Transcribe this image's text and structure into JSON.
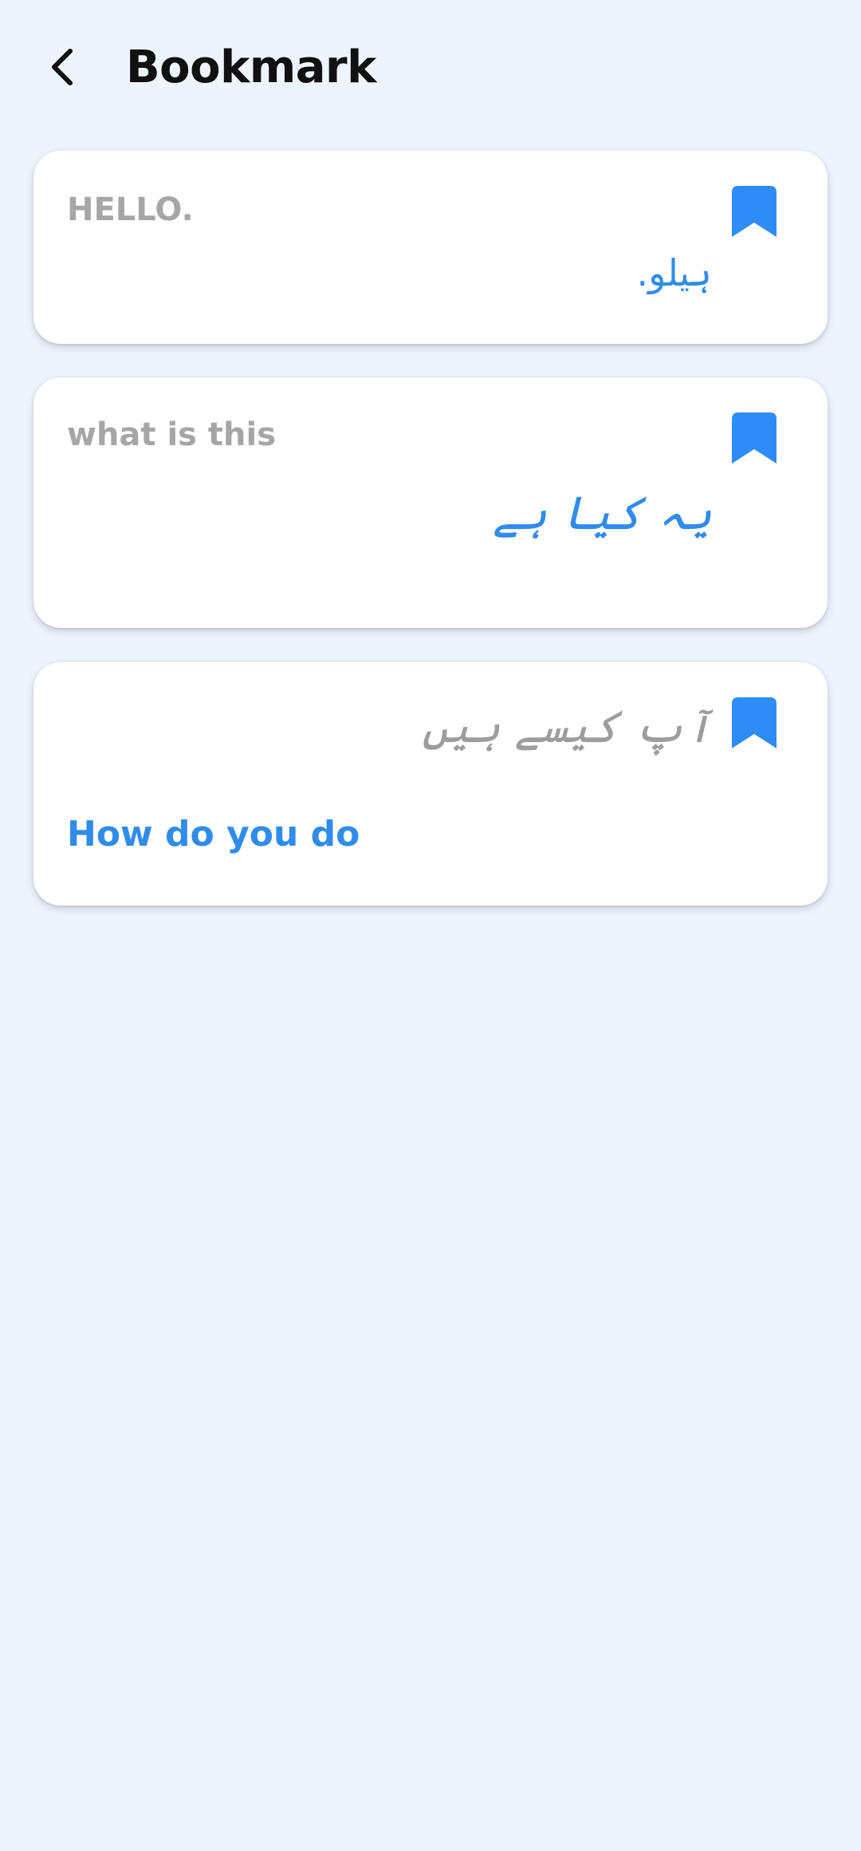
{
  "header": {
    "title": "Bookmark",
    "back_icon": "chevron-left-icon"
  },
  "colors": {
    "background": "#EEF4FE",
    "card": "#FFFFFF",
    "accent": "#2F8CEB",
    "bookmark": "#2D8CF5",
    "muted_text": "#A6A6A6",
    "title_text": "#111111"
  },
  "bookmarks": [
    {
      "source": "HELLO.",
      "translation": "ہیلو.",
      "bookmark_icon": "bookmark-filled-icon"
    },
    {
      "source": "what is this",
      "translation": "یہ کیا ہے",
      "bookmark_icon": "bookmark-filled-icon"
    },
    {
      "source": "آپ کیسے ہیں",
      "translation": "How do you do",
      "bookmark_icon": "bookmark-filled-icon"
    }
  ]
}
